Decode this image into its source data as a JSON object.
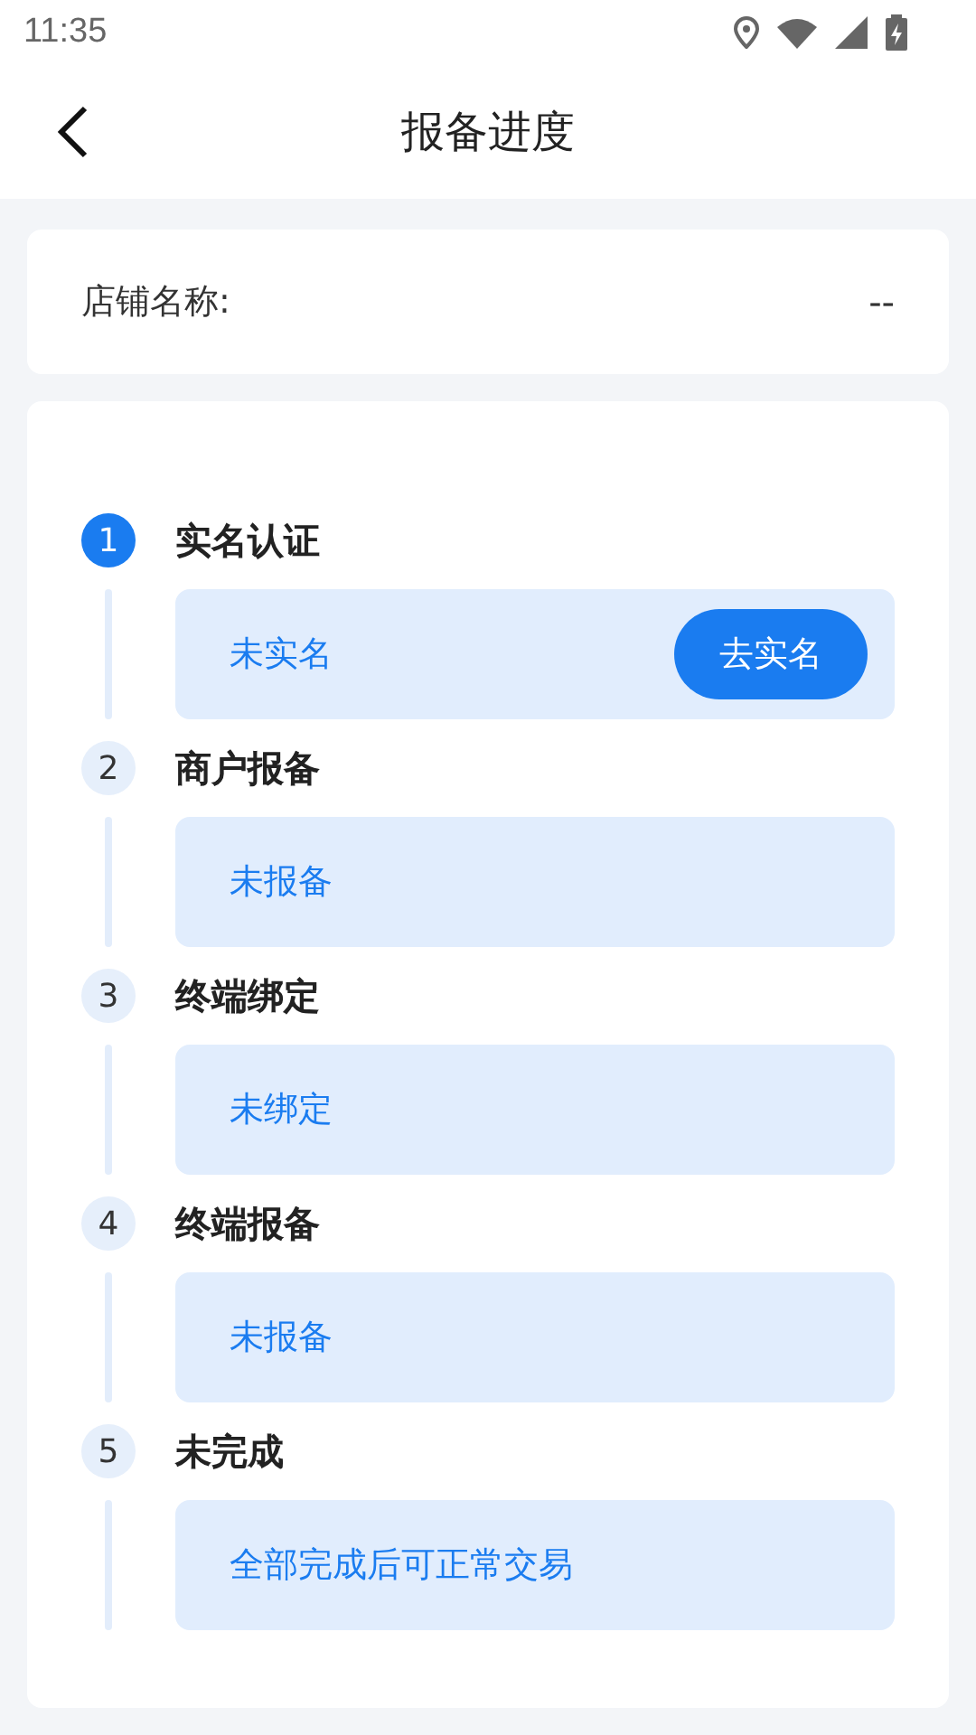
{
  "status_bar": {
    "time": "11:35"
  },
  "header": {
    "title": "报备进度"
  },
  "store": {
    "label": "店铺名称:",
    "value": "--"
  },
  "steps": [
    {
      "number": "1",
      "title": "实名认证",
      "status": "未实名",
      "active": true,
      "action": "去实名"
    },
    {
      "number": "2",
      "title": "商户报备",
      "status": "未报备",
      "active": false
    },
    {
      "number": "3",
      "title": "终端绑定",
      "status": "未绑定",
      "active": false
    },
    {
      "number": "4",
      "title": "终端报备",
      "status": "未报备",
      "active": false
    },
    {
      "number": "5",
      "title": "未完成",
      "status": "全部完成后可正常交易",
      "active": false
    }
  ]
}
